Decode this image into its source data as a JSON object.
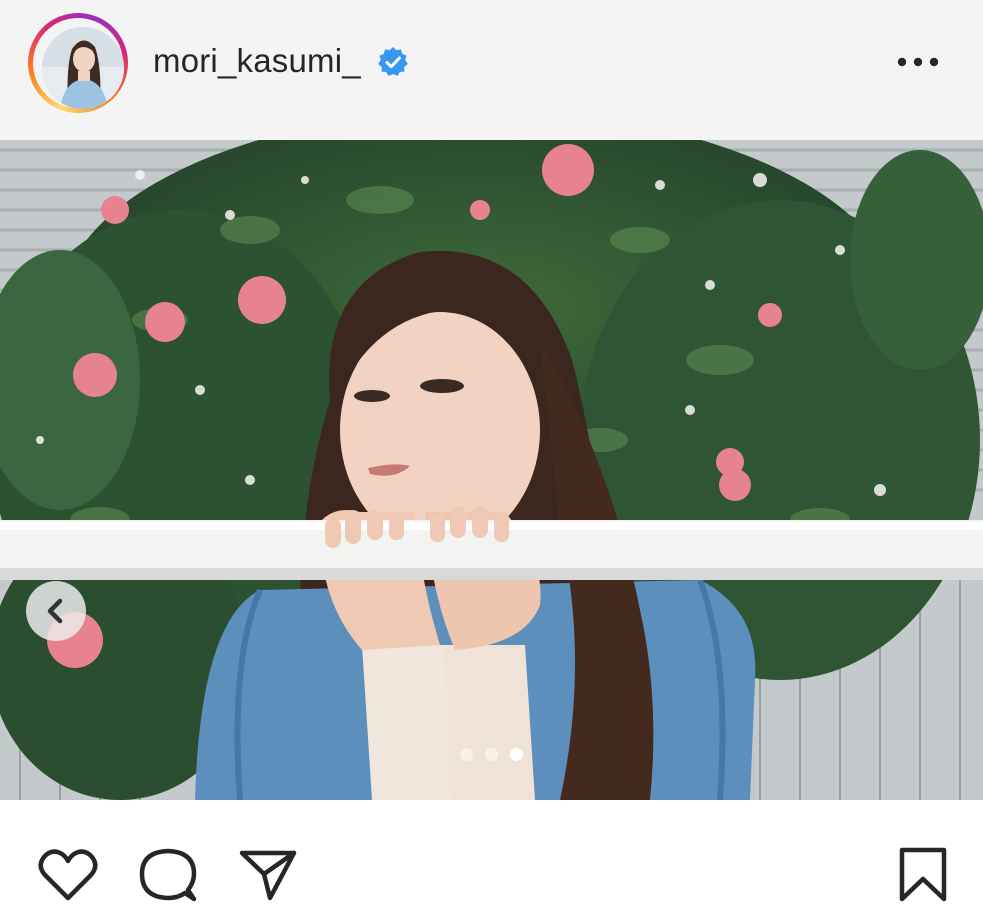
{
  "post": {
    "username": "mori_kasumi_",
    "verified": true,
    "avatar_icon": "profile-photo",
    "more_icon": "more-horizontal-icon"
  },
  "carousel": {
    "total_slides": 3,
    "current_slide": 3,
    "prev_icon": "chevron-left-icon"
  },
  "actions": {
    "icons": [
      "heart-icon",
      "comment-icon",
      "share-icon",
      "bookmark-icon"
    ]
  },
  "colors": {
    "verified_blue": "#3897f0",
    "header_bg": "#f4f4f4",
    "text": "#262626",
    "dot_active": "#ffffff",
    "dot_inactive": "rgba(255,255,255,0.55)"
  }
}
